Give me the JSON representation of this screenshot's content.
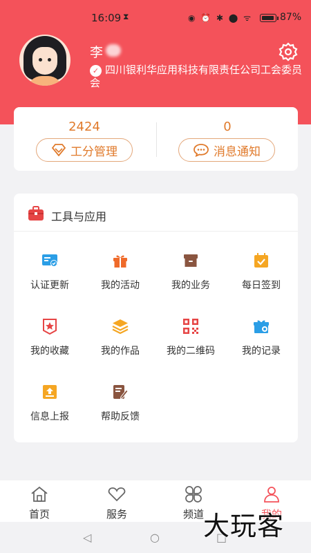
{
  "status_bar": {
    "time": "16:09",
    "hourglass": "⧗",
    "indicators": "◉ ⏰ ✱ ⬤ ᯤ",
    "battery_level": 0.87,
    "battery_pct": "87%"
  },
  "profile": {
    "name": "李",
    "verified_icon": "verified-badge-icon",
    "organization": "四川银利华应用科技有限责任公司工会委员会"
  },
  "stats": [
    {
      "value": "2424",
      "label": "工分管理",
      "icon": "diamond-icon"
    },
    {
      "value": "0",
      "label": "消息通知",
      "icon": "chat-bubble-icon"
    }
  ],
  "tools": {
    "title": "工具与应用",
    "items": [
      {
        "label": "认证更新",
        "icon": "id-card-icon",
        "color": "#2b9ee6"
      },
      {
        "label": "我的活动",
        "icon": "gift-icon",
        "color": "#ef6a2a"
      },
      {
        "label": "我的业务",
        "icon": "archive-box-icon",
        "color": "#8a5540"
      },
      {
        "label": "每日签到",
        "icon": "calendar-check-icon",
        "color": "#f5a623"
      },
      {
        "label": "我的收藏",
        "icon": "star-badge-icon",
        "color": "#e64545"
      },
      {
        "label": "我的作品",
        "icon": "layers-icon",
        "color": "#f5a623"
      },
      {
        "label": "我的二维码",
        "icon": "qr-code-icon",
        "color": "#e64545"
      },
      {
        "label": "我的记录",
        "icon": "gift-record-icon",
        "color": "#2b9ee6"
      },
      {
        "label": "信息上报",
        "icon": "upload-tray-icon",
        "color": "#f5a623"
      },
      {
        "label": "帮助反馈",
        "icon": "edit-note-icon",
        "color": "#8a5540"
      }
    ]
  },
  "bottom_nav": [
    {
      "label": "首页",
      "icon": "home-icon",
      "active": false
    },
    {
      "label": "服务",
      "icon": "heart-icon",
      "active": false
    },
    {
      "label": "频道",
      "icon": "grid-petal-icon",
      "active": false
    },
    {
      "label": "我的",
      "icon": "user-icon",
      "active": true
    }
  ],
  "system_nav": {
    "back": "◁",
    "home": "○",
    "recent": "□"
  },
  "watermark": "大玩客",
  "colors": {
    "brand": "#f4525a",
    "accent": "#e07a2b"
  }
}
